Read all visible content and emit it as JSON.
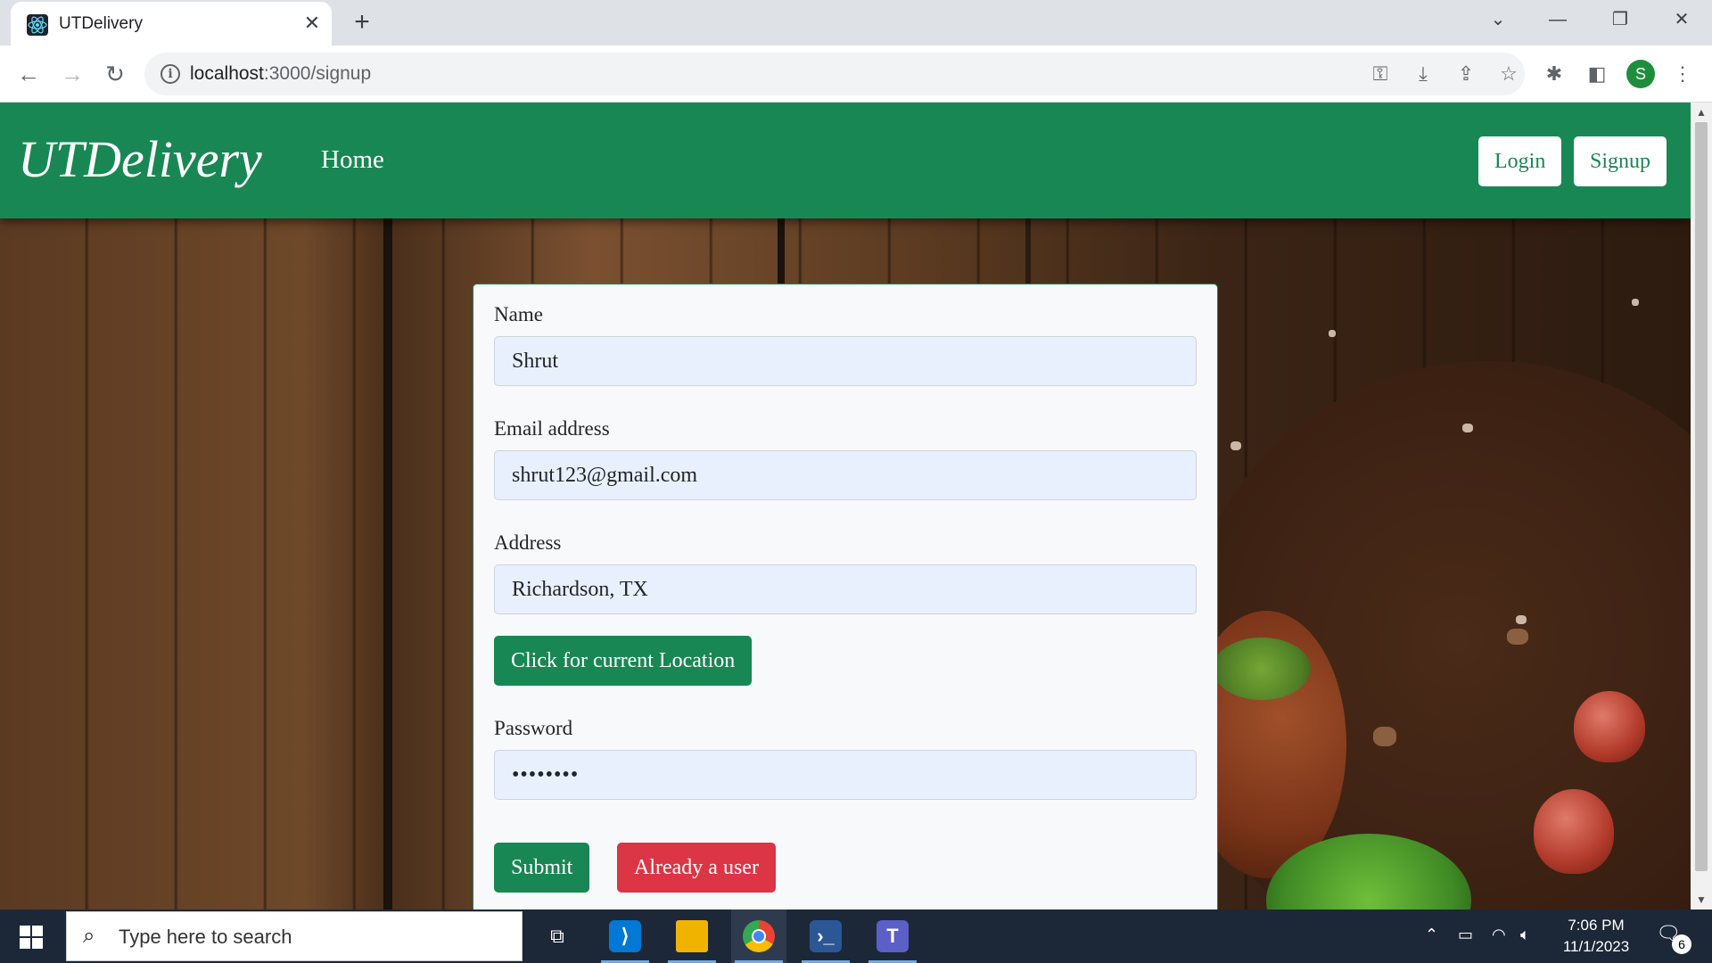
{
  "browser": {
    "tab_title": "UTDelivery",
    "tab_close": "✕",
    "new_tab": "+",
    "url_host": "localhost",
    "url_path": ":3000/signup",
    "profile_initial": "S"
  },
  "navbar": {
    "brand": "UTDelivery",
    "home": "Home",
    "login": "Login",
    "signup": "Signup",
    "color": "#198754"
  },
  "form": {
    "name_label": "Name",
    "name_value": "Shrut",
    "email_label": "Email address",
    "email_value": "shrut123@gmail.com",
    "address_label": "Address",
    "address_value": "Richardson, TX",
    "location_button": "Click for current Location",
    "password_label": "Password",
    "password_value": "••••••••",
    "submit_button": "Submit",
    "already_user_button": "Already a user"
  },
  "taskbar": {
    "search_placeholder": "Type here to search",
    "time": "7:06 PM",
    "date": "11/1/2023",
    "notification_count": "6"
  }
}
